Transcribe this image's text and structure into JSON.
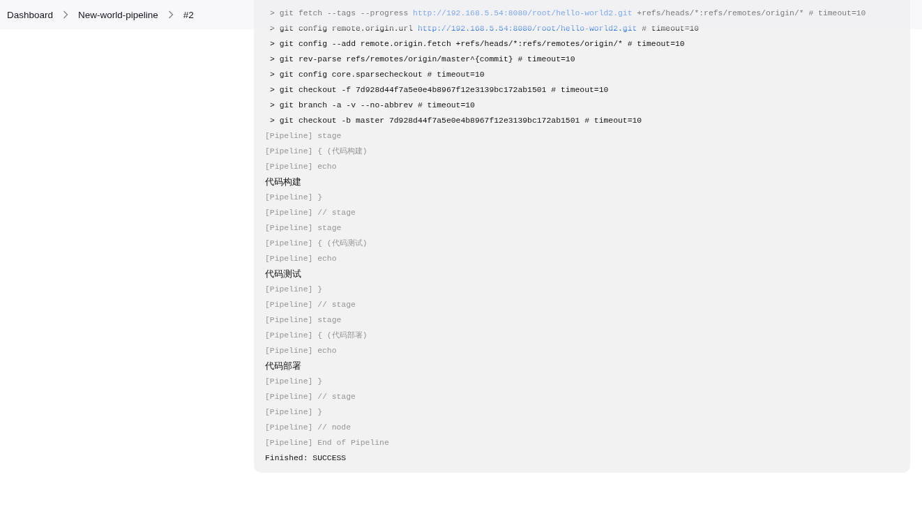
{
  "breadcrumbs": [
    {
      "label": "Dashboard"
    },
    {
      "label": "New-world-pipeline"
    },
    {
      "label": "#2"
    }
  ],
  "console": [
    {
      "kind": "cmd",
      "text": "> git fetch --tags --progress ",
      "link": "http://192.168.5.54:8080/root/hello-world2.git",
      "after": " +refs/heads/*:refs/remotes/origin/* # timeout=10"
    },
    {
      "kind": "cmd",
      "text": "> git config remote.origin.url ",
      "link": "http://192.168.5.54:8080/root/hello-world2.git",
      "after": " # timeout=10"
    },
    {
      "kind": "cmd",
      "text": "> git config --add remote.origin.fetch +refs/heads/*:refs/remotes/origin/* # timeout=10"
    },
    {
      "kind": "cmd",
      "text": "> git rev-parse refs/remotes/origin/master^{commit} # timeout=10"
    },
    {
      "kind": "cmd",
      "text": "> git config core.sparsecheckout # timeout=10"
    },
    {
      "kind": "cmd",
      "text": "> git checkout -f 7d928d44f7a5e0e4b8967f12e3139bc172ab1501 # timeout=10"
    },
    {
      "kind": "cmd",
      "text": "> git branch -a -v --no-abbrev # timeout=10"
    },
    {
      "kind": "cmd",
      "text": "> git checkout -b master 7d928d44f7a5e0e4b8967f12e3139bc172ab1501 # timeout=10"
    },
    {
      "kind": "pipeline",
      "text": "[Pipeline] stage"
    },
    {
      "kind": "pipeline",
      "text": "[Pipeline] { (代码构建)"
    },
    {
      "kind": "pipeline",
      "text": "[Pipeline] echo"
    },
    {
      "kind": "output",
      "text": "代码构建"
    },
    {
      "kind": "pipeline",
      "text": "[Pipeline] }"
    },
    {
      "kind": "pipeline",
      "text": "[Pipeline] // stage"
    },
    {
      "kind": "pipeline",
      "text": "[Pipeline] stage"
    },
    {
      "kind": "pipeline",
      "text": "[Pipeline] { (代码测试)"
    },
    {
      "kind": "pipeline",
      "text": "[Pipeline] echo"
    },
    {
      "kind": "output",
      "text": "代码测试"
    },
    {
      "kind": "pipeline",
      "text": "[Pipeline] }"
    },
    {
      "kind": "pipeline",
      "text": "[Pipeline] // stage"
    },
    {
      "kind": "pipeline",
      "text": "[Pipeline] stage"
    },
    {
      "kind": "pipeline",
      "text": "[Pipeline] { (代码部署)"
    },
    {
      "kind": "pipeline",
      "text": "[Pipeline] echo"
    },
    {
      "kind": "output",
      "text": "代码部署"
    },
    {
      "kind": "pipeline",
      "text": "[Pipeline] }"
    },
    {
      "kind": "pipeline",
      "text": "[Pipeline] // stage"
    },
    {
      "kind": "pipeline",
      "text": "[Pipeline] }"
    },
    {
      "kind": "pipeline",
      "text": "[Pipeline] // node"
    },
    {
      "kind": "pipeline",
      "text": "[Pipeline] End of Pipeline"
    },
    {
      "kind": "output",
      "text": "Finished: SUCCESS"
    }
  ]
}
